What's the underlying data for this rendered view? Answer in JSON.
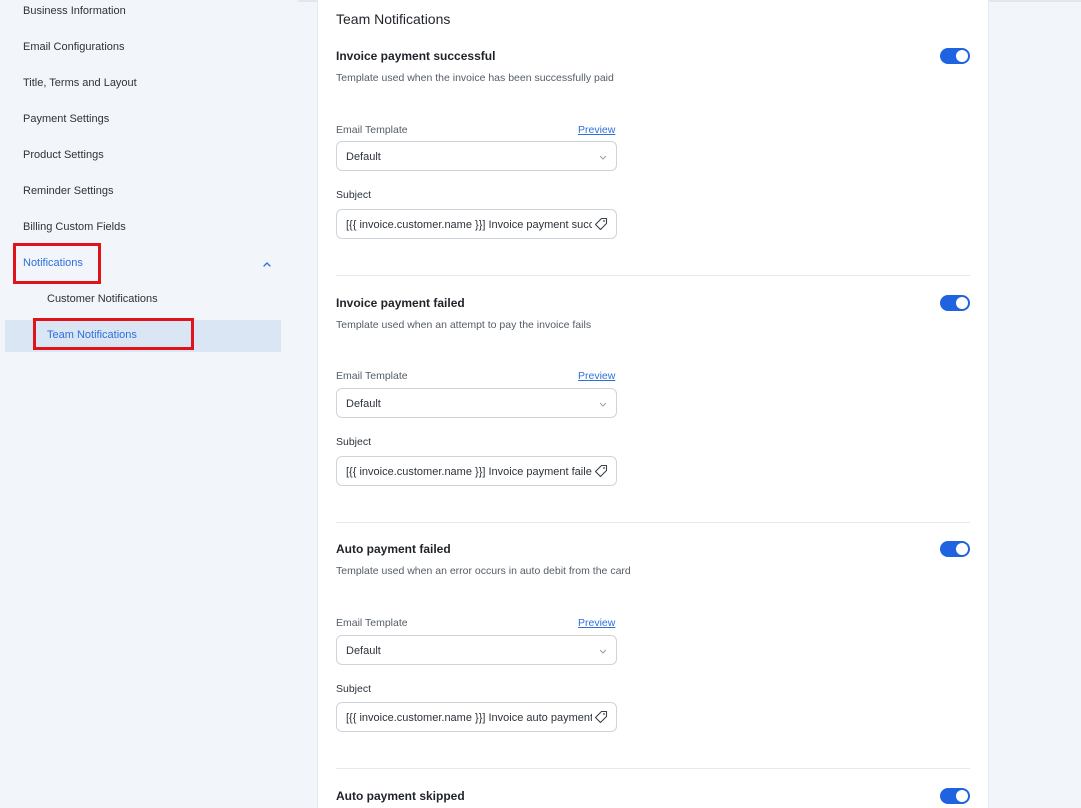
{
  "sidebar": {
    "items": [
      {
        "label": "Business Information"
      },
      {
        "label": "Email Configurations"
      },
      {
        "label": "Title, Terms and Layout"
      },
      {
        "label": "Payment Settings"
      },
      {
        "label": "Product Settings"
      },
      {
        "label": "Reminder Settings"
      },
      {
        "label": "Billing Custom Fields"
      },
      {
        "label": "Notifications"
      },
      {
        "label": "Customer Notifications"
      },
      {
        "label": "Team Notifications"
      }
    ]
  },
  "main": {
    "title": "Team Notifications",
    "sections": [
      {
        "title": "Invoice payment successful",
        "description": "Template used when the invoice has been successfully paid",
        "email_template_label": "Email Template",
        "preview_label": "Preview",
        "template_value": "Default",
        "subject_label": "Subject",
        "subject_value": "[{{ invoice.customer.name }}] Invoice payment successful",
        "enabled": true
      },
      {
        "title": "Invoice payment failed",
        "description": "Template used when an attempt to pay the invoice fails",
        "email_template_label": "Email Template",
        "preview_label": "Preview",
        "template_value": "Default",
        "subject_label": "Subject",
        "subject_value": "[{{ invoice.customer.name }}] Invoice payment failed",
        "enabled": true
      },
      {
        "title": "Auto payment failed",
        "description": "Template used when an error occurs in auto debit from the card",
        "email_template_label": "Email Template",
        "preview_label": "Preview",
        "template_value": "Default",
        "subject_label": "Subject",
        "subject_value": "[{{ invoice.customer.name }}] Invoice auto payment failed",
        "enabled": true
      },
      {
        "title": "Auto payment skipped",
        "enabled": true
      }
    ]
  },
  "colors": {
    "accent": "#1f63e0",
    "link": "#2f6fdb",
    "highlight": "#e0121a",
    "active_bg": "#dbe6f5"
  }
}
